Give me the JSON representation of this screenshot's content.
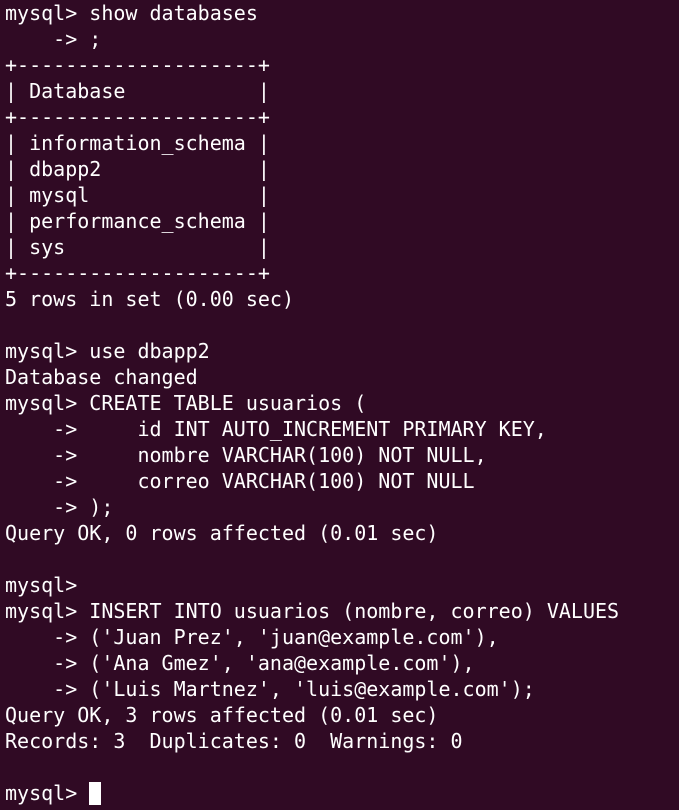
{
  "terminal": {
    "background_color": "#300a24",
    "text_color": "#ffffff",
    "lines": [
      "mysql> show databases",
      "    -> ;",
      "+--------------------+",
      "| Database           |",
      "+--------------------+",
      "| information_schema |",
      "| dbapp2             |",
      "| mysql              |",
      "| performance_schema |",
      "| sys                |",
      "+--------------------+",
      "5 rows in set (0.00 sec)",
      "",
      "mysql> use dbapp2",
      "Database changed",
      "mysql> CREATE TABLE usuarios (",
      "    ->     id INT AUTO_INCREMENT PRIMARY KEY,",
      "    ->     nombre VARCHAR(100) NOT NULL,",
      "    ->     correo VARCHAR(100) NOT NULL",
      "    -> );",
      "Query OK, 0 rows affected (0.01 sec)",
      "",
      "mysql>",
      "mysql> INSERT INTO usuarios (nombre, correo) VALUES",
      "    -> ('Juan Prez', 'juan@example.com'),",
      "    -> ('Ana Gmez', 'ana@example.com'),",
      "    -> ('Luis Martnez', 'luis@example.com');",
      "Query OK, 3 rows affected (0.01 sec)",
      "Records: 3  Duplicates: 0  Warnings: 0",
      ""
    ],
    "prompt": "mysql>"
  }
}
